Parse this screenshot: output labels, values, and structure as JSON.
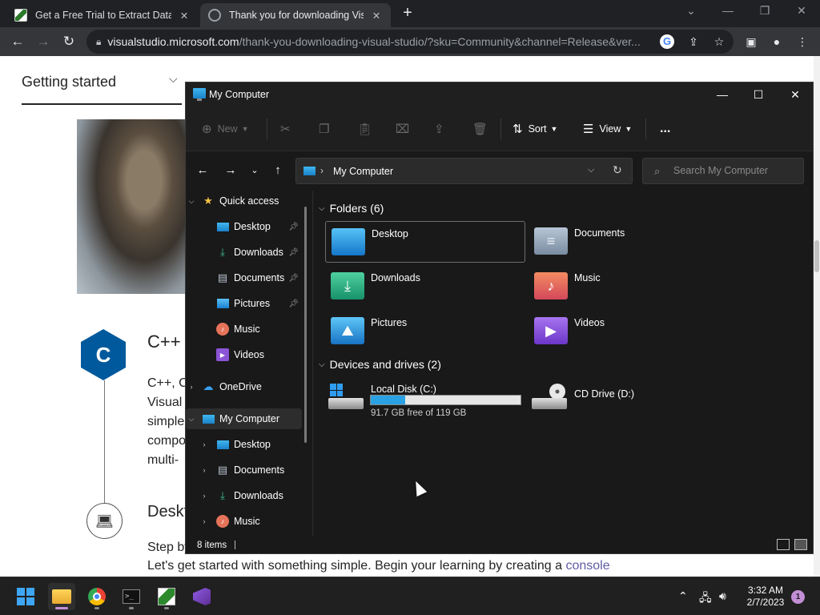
{
  "browser": {
    "tabs": [
      {
        "title": "Get a Free Trial to Extract Data fr",
        "active": false
      },
      {
        "title": "Thank you for downloading Visua",
        "active": true
      }
    ],
    "url_host": "visualstudio.microsoft.com",
    "url_path": "/thank-you-downloading-visual-studio/?sku=Community&channel=Release&ver..."
  },
  "page": {
    "getting_started": "Getting started",
    "cpp_heading": "C++",
    "cpp_body": [
      "C++, C",
      "Visual",
      "simple",
      "compo",
      "multi-"
    ],
    "desktop_heading": "Deskt",
    "step_line": "Step by step",
    "lets_line_text": "Let's get started with something simple. Begin your learning by creating a ",
    "lets_line_link": "console"
  },
  "explorer": {
    "title": "My Computer",
    "toolbar": {
      "new": "New",
      "sort": "Sort",
      "view": "View",
      "more": "..."
    },
    "address": "My Computer",
    "search_placeholder": "Search My Computer",
    "sidebar": {
      "quick_access": "Quick access",
      "quick_items": [
        "Desktop",
        "Downloads",
        "Documents",
        "Pictures",
        "Music",
        "Videos"
      ],
      "onedrive": "OneDrive",
      "my_computer": "My Computer",
      "computer_items": [
        "Desktop",
        "Documents",
        "Downloads",
        "Music"
      ]
    },
    "folders_header": "Folders (6)",
    "folders": [
      "Desktop",
      "Documents",
      "Downloads",
      "Music",
      "Pictures",
      "Videos"
    ],
    "drives_header": "Devices and drives (2)",
    "drives": [
      {
        "name": "Local Disk (C:)",
        "free": "91.7 GB free of 119 GB",
        "used_fraction": 0.23
      },
      {
        "name": "CD Drive (D:)"
      }
    ],
    "status": "8 items"
  },
  "taskbar": {
    "time": "3:32 AM",
    "date": "2/7/2023",
    "notifications": "1"
  }
}
